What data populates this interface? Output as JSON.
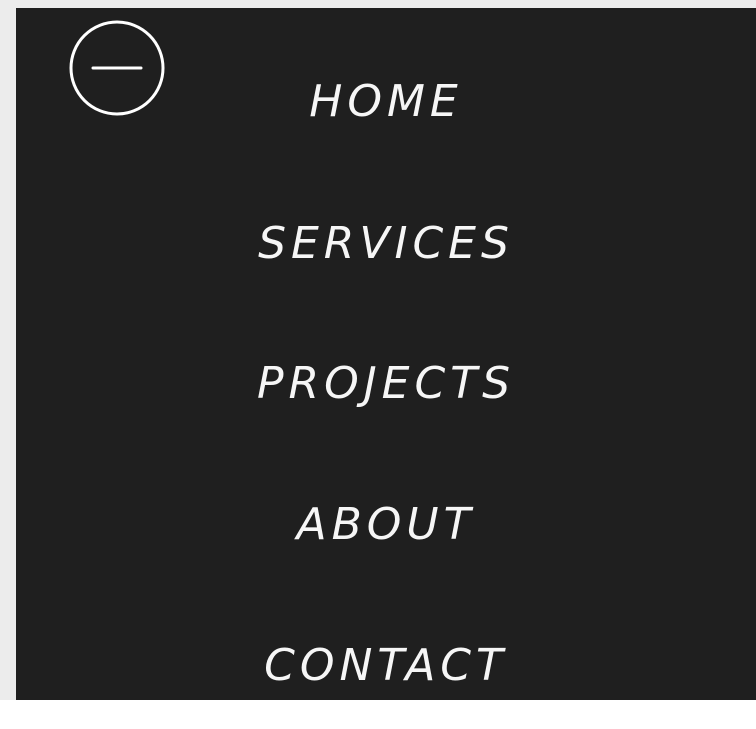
{
  "menu": {
    "items": [
      {
        "label": "HOME"
      },
      {
        "label": "SERVICES"
      },
      {
        "label": "PROJECTS"
      },
      {
        "label": "ABOUT"
      },
      {
        "label": "CONTACT"
      }
    ],
    "close_icon": "minus-circle-icon"
  },
  "colors": {
    "panel_background": "#1f1f1f",
    "menu_text": "#f6f6f6",
    "page_background": "#ececec"
  }
}
